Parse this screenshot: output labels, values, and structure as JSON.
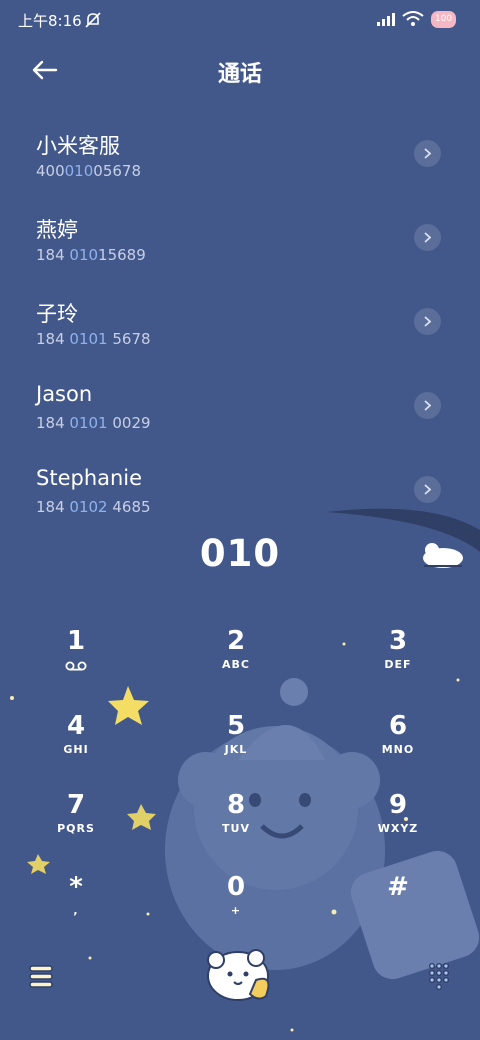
{
  "status_bar": {
    "time": "上午8:16",
    "battery": "100"
  },
  "header": {
    "title": "通话"
  },
  "contacts": [
    {
      "name": "小米客服",
      "num_pre": "400",
      "num_hl": "010",
      "num_post": "05678"
    },
    {
      "name": "燕婷",
      "num_pre": "184 ",
      "num_hl": "010",
      "num_post": "15689"
    },
    {
      "name": "子玲",
      "num_pre": "184 ",
      "num_hl": "0101",
      "num_post": " 5678"
    },
    {
      "name": "Jason",
      "num_pre": "184 ",
      "num_hl": "0101",
      "num_post": " 0029"
    },
    {
      "name": "Stephanie",
      "num_pre": "184 ",
      "num_hl": "0102",
      "num_post": " 4685"
    }
  ],
  "dialed": "010",
  "keypad": [
    {
      "digit": "1",
      "letters": ""
    },
    {
      "digit": "2",
      "letters": "ABC"
    },
    {
      "digit": "3",
      "letters": "DEF"
    },
    {
      "digit": "4",
      "letters": "GHI"
    },
    {
      "digit": "5",
      "letters": "JKL"
    },
    {
      "digit": "6",
      "letters": "MNO"
    },
    {
      "digit": "7",
      "letters": "PQRS"
    },
    {
      "digit": "8",
      "letters": "TUV"
    },
    {
      "digit": "9",
      "letters": "WXYZ"
    },
    {
      "digit": "*",
      "letters": ","
    },
    {
      "digit": "0",
      "letters": "+"
    },
    {
      "digit": "#",
      "letters": ""
    }
  ],
  "icons": {
    "voicemail": "voicemail-icon",
    "menu": "menu-icon",
    "dialpad": "dialpad-icon",
    "call": "call-icon",
    "back": "back-arrow-icon"
  },
  "colors": {
    "background": "#43588a",
    "highlight": "#8fb2ee",
    "secondary_text": "#c7cfe6"
  }
}
